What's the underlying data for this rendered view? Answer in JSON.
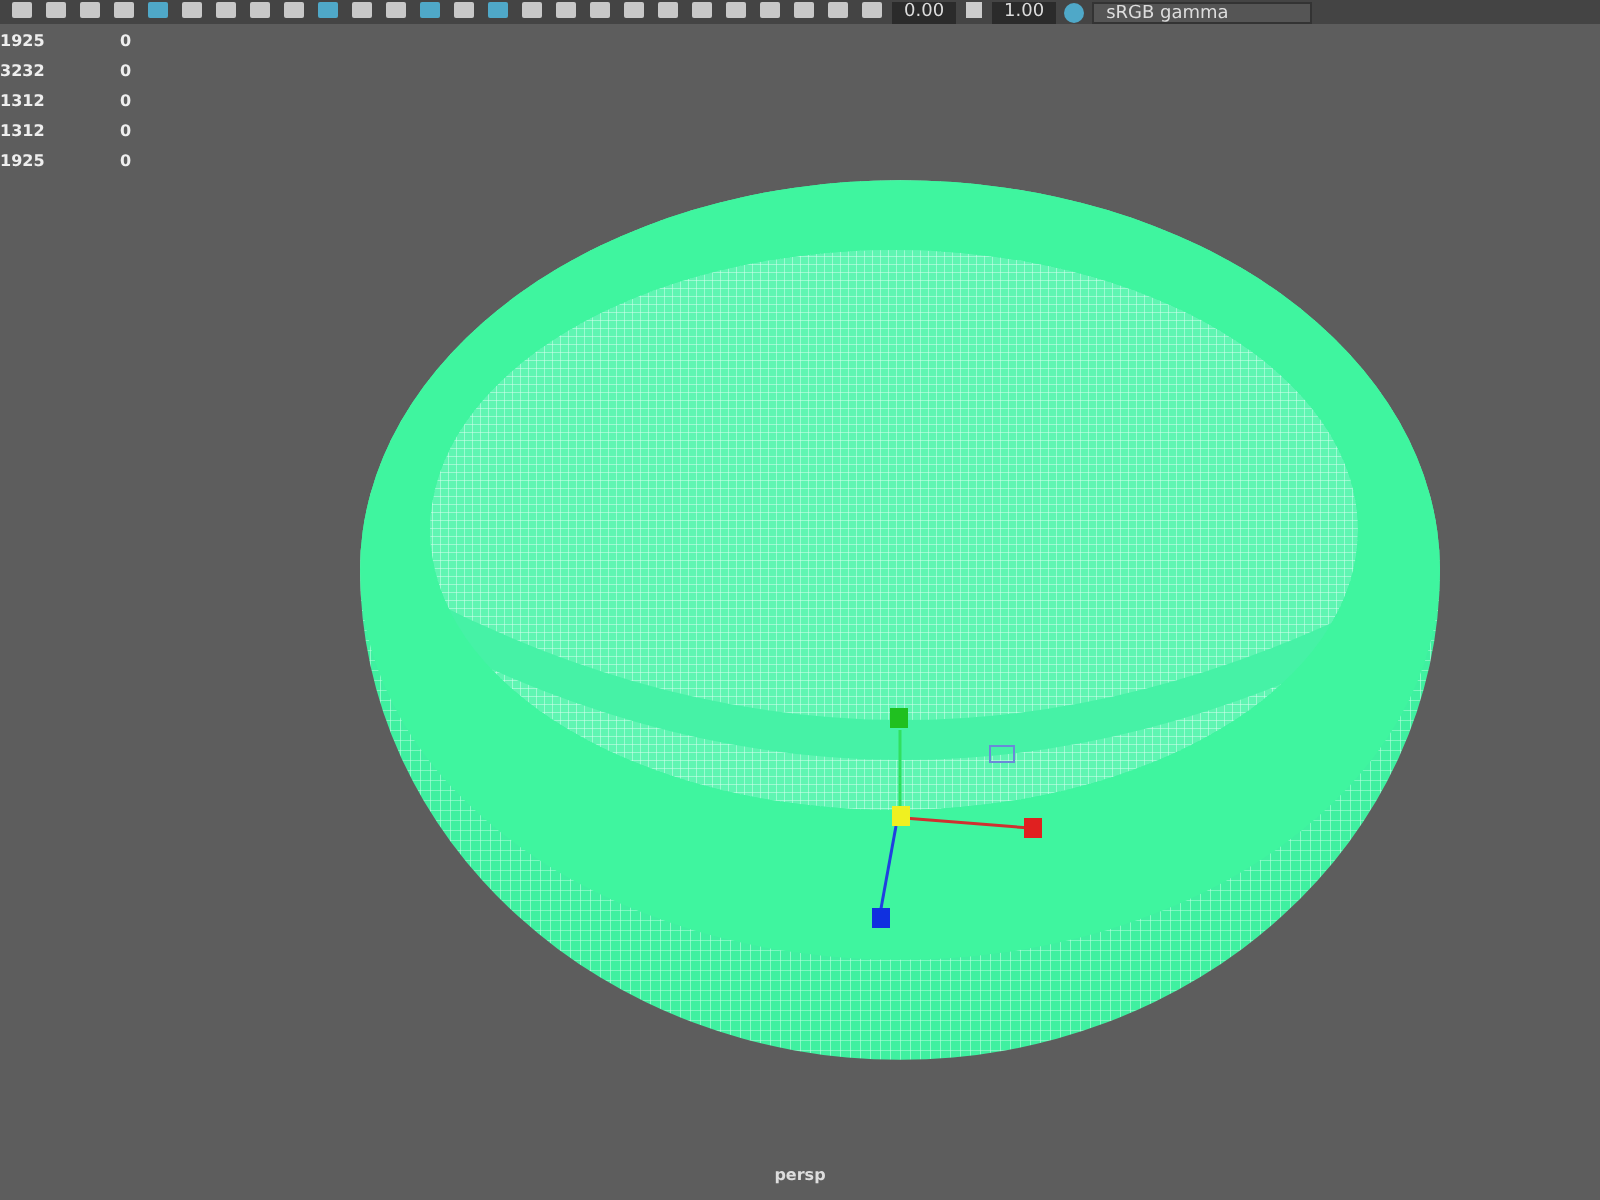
{
  "toolbar": {
    "fields": [
      "0.00",
      "1.00"
    ],
    "colorspace": "sRGB gamma"
  },
  "hud_stats": [
    {
      "column_1": "1925",
      "column_2": "0"
    },
    {
      "column_1": "3232",
      "column_2": "0"
    },
    {
      "column_1": "1312",
      "column_2": "0"
    },
    {
      "column_1": "1312",
      "column_2": "0"
    },
    {
      "column_1": "1925",
      "column_2": "0"
    }
  ],
  "camera_label": "persp"
}
